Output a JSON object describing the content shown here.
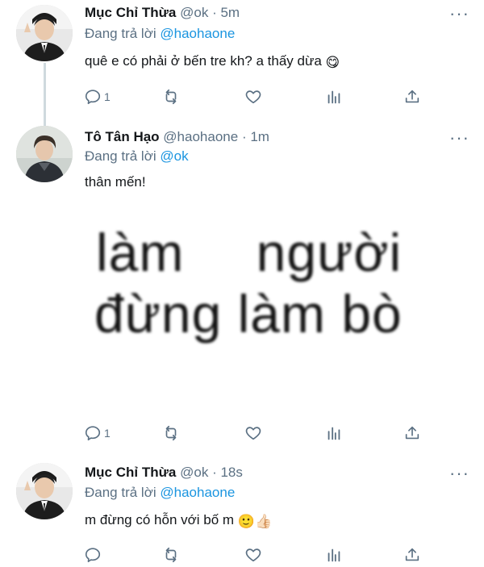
{
  "tweets": [
    {
      "display_name": "Mục Chỉ Thừa",
      "handle": "@ok",
      "separator": "·",
      "time": "5m",
      "reply_prefix": "Đang trả lời",
      "reply_to": "@haohaone",
      "text": "quê e có phải ở bến tre kh? a thấy dừa",
      "emoji": "😋",
      "reply_count": "1",
      "avatar_icon": "profile-photo-man-suit"
    },
    {
      "display_name": "Tô Tân Hạo",
      "handle": "@haohaone",
      "separator": "·",
      "time": "1m",
      "reply_prefix": "Đang trả lời",
      "reply_to": "@ok",
      "text": "thân mến!",
      "media_line1": "làm người",
      "media_line2": "đừng làm bò",
      "reply_count": "1",
      "avatar_icon": "profile-photo-man-jacket"
    },
    {
      "display_name": "Mục Chỉ Thừa",
      "handle": "@ok",
      "separator": "·",
      "time": "18s",
      "reply_prefix": "Đang trả lời",
      "reply_to": "@haohaone",
      "text": "m đừng có hỗn với bố m",
      "emoji": "🙂👍🏻",
      "reply_count": "",
      "avatar_icon": "profile-photo-man-suit"
    }
  ],
  "icons": {
    "more": "more-dots-icon",
    "reply": "reply-icon",
    "retweet": "retweet-icon",
    "like": "like-icon",
    "analytics": "analytics-icon",
    "share": "share-icon"
  },
  "colors": {
    "text": "#14171a",
    "secondary": "#5b7083",
    "link": "#1b95e0",
    "thread": "#cfd9de"
  }
}
